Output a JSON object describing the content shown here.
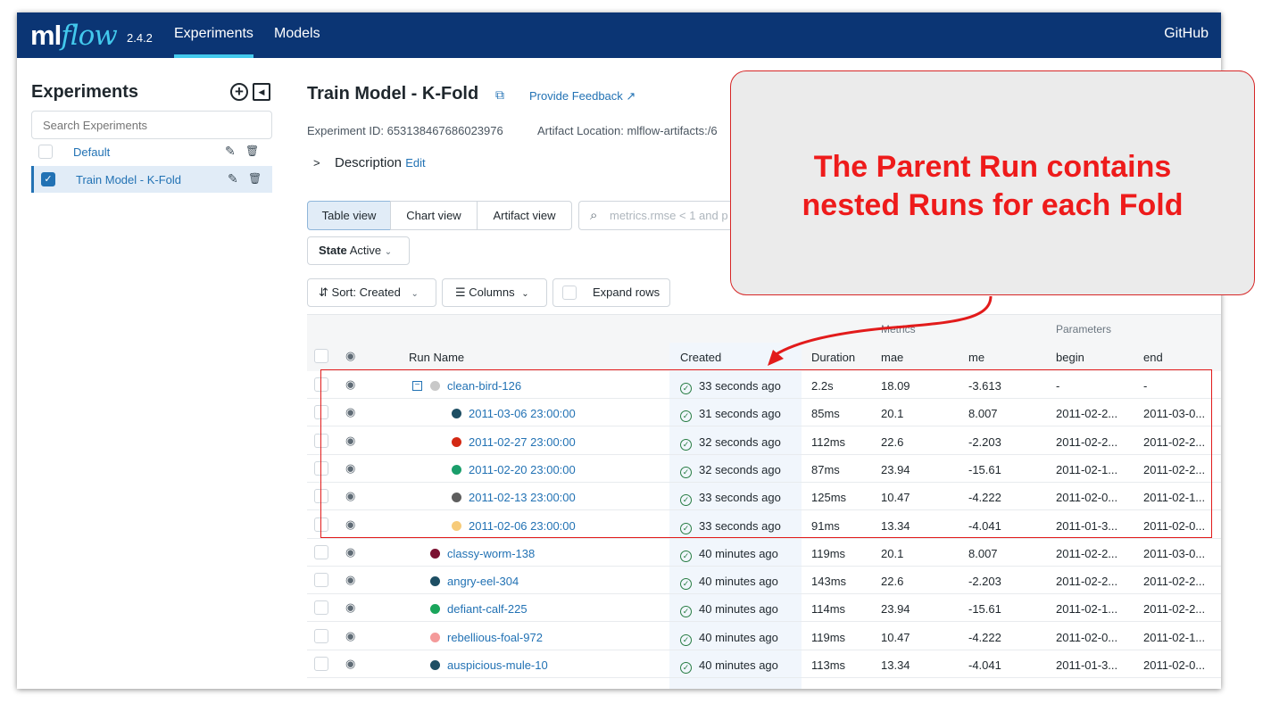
{
  "header": {
    "logo_ml": "ml",
    "logo_flow": "flow",
    "version": "2.4.2",
    "nav": [
      {
        "label": "Experiments"
      },
      {
        "label": "Models"
      }
    ],
    "github": "GitHub"
  },
  "sidebar": {
    "title": "Experiments",
    "search_placeholder": "Search Experiments",
    "items": [
      {
        "label": "Default",
        "selected": false
      },
      {
        "label": "Train Model - K-Fold",
        "selected": true
      }
    ]
  },
  "experiment": {
    "title": "Train Model - K-Fold",
    "feedback": "Provide Feedback",
    "id_text": "Experiment ID: 653138467686023976",
    "artifact_text": "Artifact Location: mlflow-artifacts:/6",
    "description": "Description",
    "edit": "Edit"
  },
  "toolbar": {
    "views": [
      "Table view",
      "Chart view",
      "Artifact view"
    ],
    "search_placeholder": "metrics.rmse < 1 and p",
    "state_label": "State",
    "state_value": "Active",
    "sort": "Sort: Created",
    "columns": "Columns",
    "expand_rows": "Expand rows"
  },
  "table": {
    "group_headers": {
      "metrics": "Metrics",
      "parameters": "Parameters"
    },
    "columns": [
      "Run Name",
      "Created",
      "Duration",
      "mae",
      "me",
      "begin",
      "end"
    ],
    "rows": [
      {
        "name": "clean-bird-126",
        "color": "#c8c8c8",
        "parent": true,
        "child": false,
        "created": "33 seconds ago",
        "duration": "2.2s",
        "mae": "18.09",
        "me": "-3.613",
        "begin": "-",
        "end": "-"
      },
      {
        "name": "2011-03-06 23:00:00",
        "color": "#1d4e63",
        "parent": false,
        "child": true,
        "created": "31 seconds ago",
        "duration": "85ms",
        "mae": "20.1",
        "me": "8.007",
        "begin": "2011-02-2...",
        "end": "2011-03-0..."
      },
      {
        "name": "2011-02-27 23:00:00",
        "color": "#d32914",
        "parent": false,
        "child": true,
        "created": "32 seconds ago",
        "duration": "112ms",
        "mae": "22.6",
        "me": "-2.203",
        "begin": "2011-02-2...",
        "end": "2011-02-2..."
      },
      {
        "name": "2011-02-20 23:00:00",
        "color": "#1a9e6b",
        "parent": false,
        "child": true,
        "created": "32 seconds ago",
        "duration": "87ms",
        "mae": "23.94",
        "me": "-15.61",
        "begin": "2011-02-1...",
        "end": "2011-02-2..."
      },
      {
        "name": "2011-02-13 23:00:00",
        "color": "#5e5e5e",
        "parent": false,
        "child": true,
        "created": "33 seconds ago",
        "duration": "125ms",
        "mae": "10.47",
        "me": "-4.222",
        "begin": "2011-02-0...",
        "end": "2011-02-1..."
      },
      {
        "name": "2011-02-06 23:00:00",
        "color": "#f7cb7a",
        "parent": false,
        "child": true,
        "created": "33 seconds ago",
        "duration": "91ms",
        "mae": "13.34",
        "me": "-4.041",
        "begin": "2011-01-3...",
        "end": "2011-02-0..."
      },
      {
        "name": "classy-worm-138",
        "color": "#7b1131",
        "parent": false,
        "child": false,
        "created": "40 minutes ago",
        "duration": "119ms",
        "mae": "20.1",
        "me": "8.007",
        "begin": "2011-02-2...",
        "end": "2011-03-0..."
      },
      {
        "name": "angry-eel-304",
        "color": "#1d4e63",
        "parent": false,
        "child": false,
        "created": "40 minutes ago",
        "duration": "143ms",
        "mae": "22.6",
        "me": "-2.203",
        "begin": "2011-02-2...",
        "end": "2011-02-2..."
      },
      {
        "name": "defiant-calf-225",
        "color": "#1aa55b",
        "parent": false,
        "child": false,
        "created": "40 minutes ago",
        "duration": "114ms",
        "mae": "23.94",
        "me": "-15.61",
        "begin": "2011-02-1...",
        "end": "2011-02-2..."
      },
      {
        "name": "rebellious-foal-972",
        "color": "#f49a9a",
        "parent": false,
        "child": false,
        "created": "40 minutes ago",
        "duration": "119ms",
        "mae": "10.47",
        "me": "-4.222",
        "begin": "2011-02-0...",
        "end": "2011-02-1..."
      },
      {
        "name": "auspicious-mule-10",
        "color": "#1d4e63",
        "parent": false,
        "child": false,
        "created": "40 minutes ago",
        "duration": "113ms",
        "mae": "13.34",
        "me": "-4.041",
        "begin": "2011-01-3...",
        "end": "2011-02-0..."
      }
    ]
  },
  "annotation": {
    "line1": "The Parent Run contains",
    "line2": "nested Runs for each Fold"
  },
  "colors": {
    "header_bg": "#0b3574",
    "accent": "#43c9ed",
    "link": "#2272b4",
    "annotation_red": "#ee1b1b"
  }
}
